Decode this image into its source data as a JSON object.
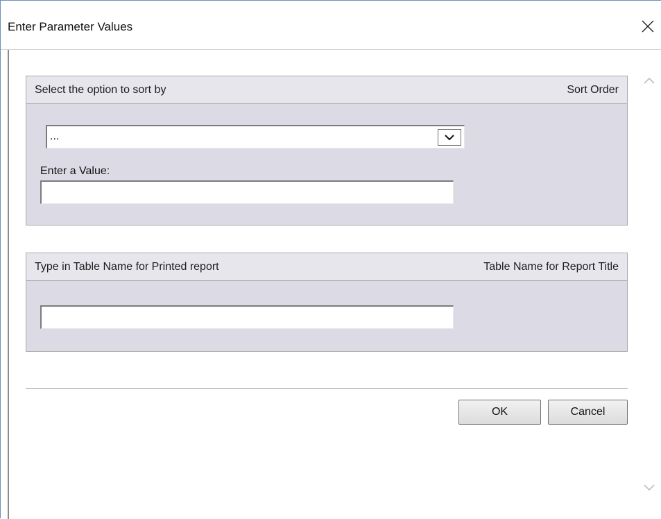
{
  "window": {
    "title": "Enter Parameter Values"
  },
  "sort_section": {
    "header_left": "Select the option to sort by",
    "header_right": "Sort Order",
    "dropdown_value": "...",
    "value_label": "Enter a Value:",
    "value_input": ""
  },
  "table_section": {
    "header_left": "Type in Table Name for Printed report",
    "header_right": "Table Name for Report Title",
    "table_input": ""
  },
  "buttons": {
    "ok_label": "OK",
    "cancel_label": "Cancel"
  },
  "icons": {
    "close": "close-icon",
    "dropdown": "chevron-down-icon",
    "scroll_up": "chevron-up-icon",
    "scroll_down": "chevron-down-icon"
  }
}
